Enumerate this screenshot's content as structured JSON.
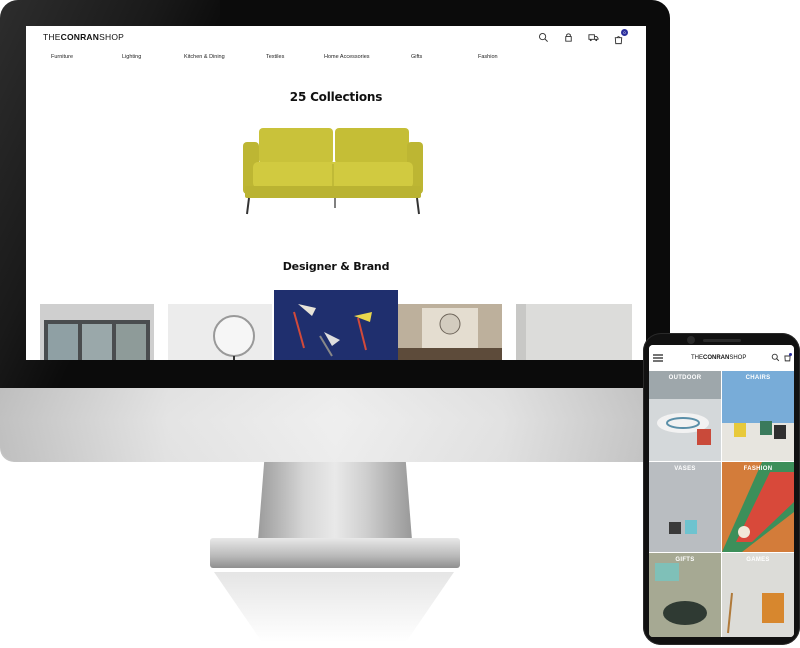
{
  "desktop": {
    "logo": {
      "part1": "THE",
      "part2": "CONRAN",
      "part3": "SHOP"
    },
    "nav": [
      "Furniture",
      "Lighting",
      "Kitchen & Dining",
      "Textiles",
      "Home Accessories",
      "Gifts",
      "Fashion"
    ],
    "header_icons": [
      "search-icon",
      "store-icon",
      "delivery-truck-icon",
      "bag-icon"
    ],
    "cart_count": "0",
    "collections_title": "25 Collections",
    "designer_title": "Designer & Brand",
    "colors": {
      "sofa": "#cbc63a",
      "badge": "#2b2f9c"
    }
  },
  "mobile": {
    "logo": {
      "part1": "THE",
      "part2": "CONRAN",
      "part3": "SHOP"
    },
    "tiles": [
      "OUTDOOR",
      "CHAIRS",
      "VASES",
      "FASHION",
      "GIFTS",
      "GAMES"
    ],
    "header_icons": [
      "menu-icon",
      "search-icon",
      "bag-icon"
    ]
  }
}
